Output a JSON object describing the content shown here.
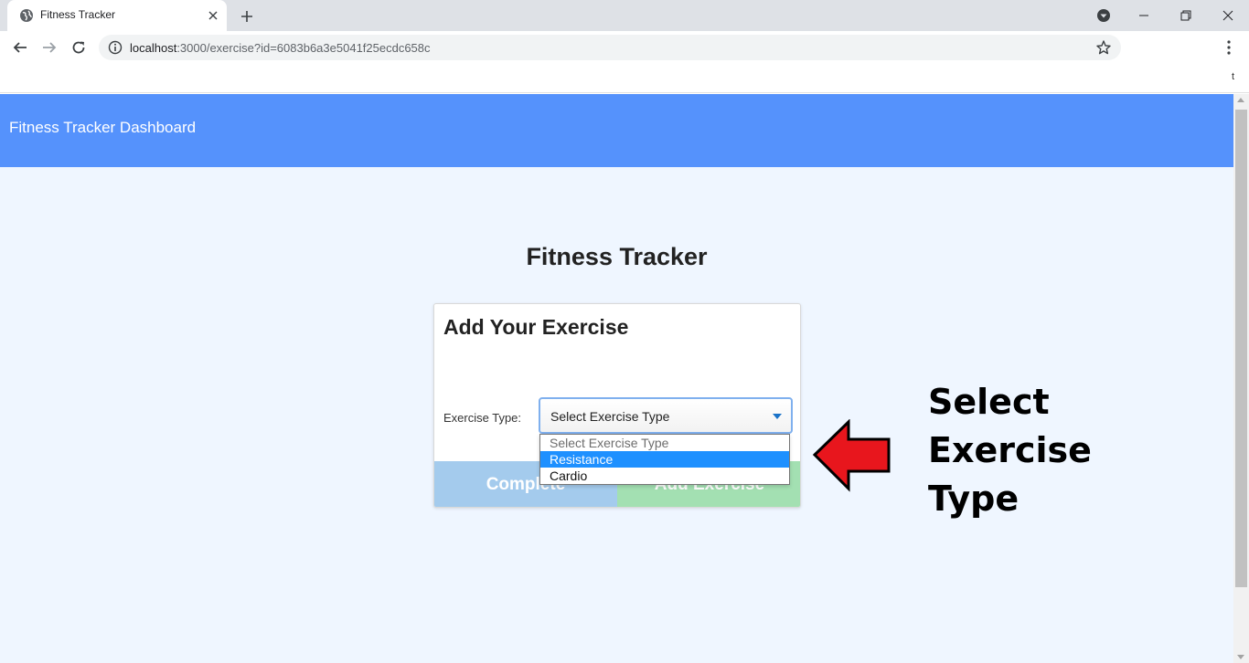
{
  "browser": {
    "tab_title": "Fitness Tracker",
    "url_host": "localhost",
    "url_path": ":3000/exercise?id=6083b6a3e5041f25ecdc658c",
    "bookmark_bar_text": "t"
  },
  "app": {
    "brand": "Fitness Tracker Dashboard",
    "page_title": "Fitness Tracker"
  },
  "form": {
    "title": "Add Your Exercise",
    "type_label": "Exercise Type:",
    "select_value": "Select Exercise Type",
    "options": [
      {
        "label": "Select Exercise Type",
        "state": "placeholder"
      },
      {
        "label": "Resistance",
        "state": "highlighted"
      },
      {
        "label": "Cardio",
        "state": "normal"
      }
    ],
    "complete_label": "Complete",
    "add_label": "Add Exercise"
  },
  "annotation": {
    "line1": "Select",
    "line2": "Exercise",
    "line3": "Type",
    "arrow_color": "#e8161d"
  },
  "colors": {
    "appbar": "#5592fc",
    "page_bg": "#eff6ff",
    "complete": "#a4cbed",
    "add": "#a3e0b2",
    "highlight": "#1e90ff"
  }
}
